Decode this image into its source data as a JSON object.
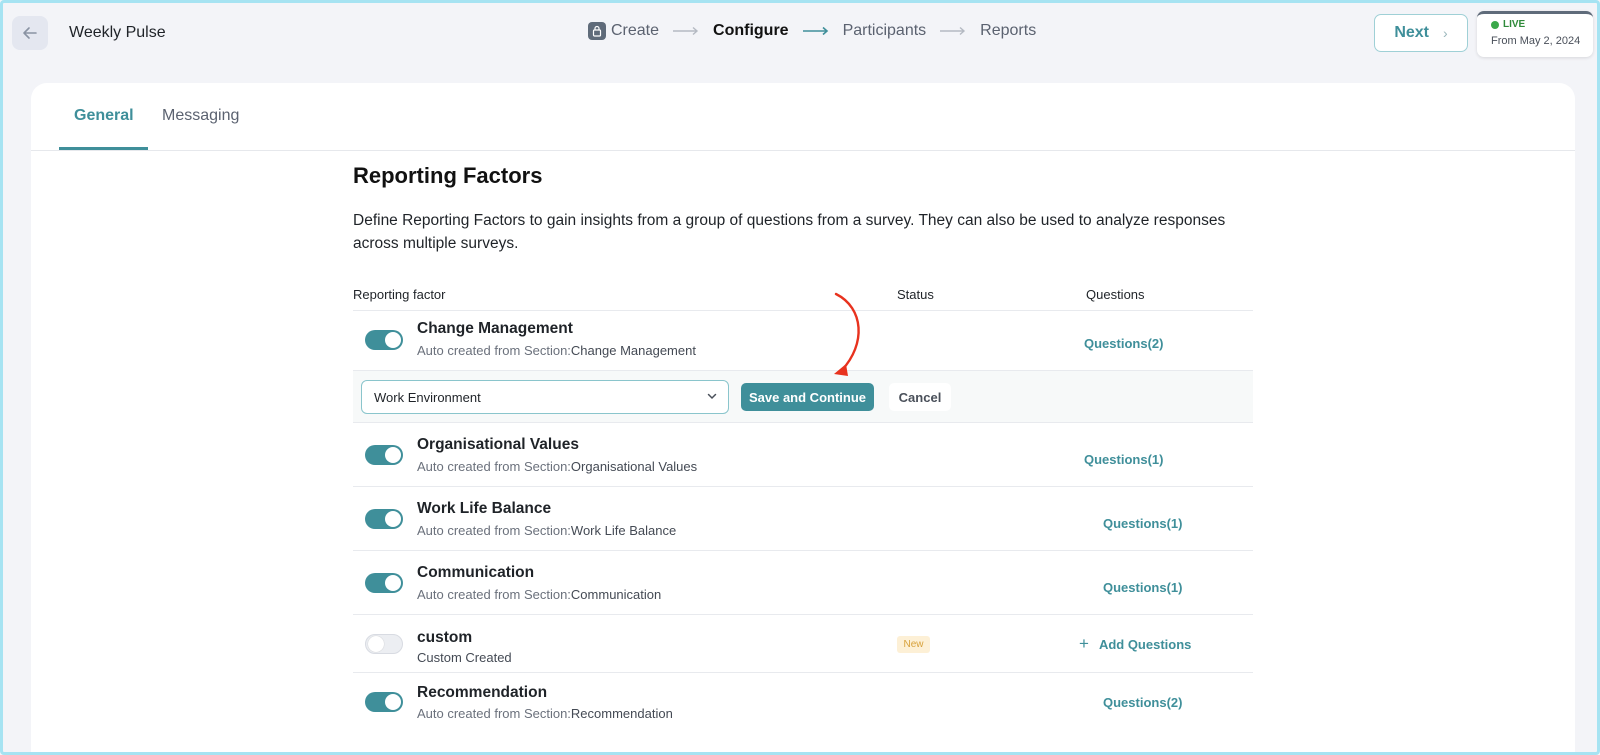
{
  "header": {
    "title": "Weekly Pulse",
    "steps": [
      {
        "label": "Create"
      },
      {
        "label": "Configure"
      },
      {
        "label": "Participants"
      },
      {
        "label": "Reports"
      }
    ],
    "next_label": "Next",
    "live_label": "LIVE",
    "live_date": "From May 2, 2024"
  },
  "tabs": [
    {
      "label": "General"
    },
    {
      "label": "Messaging"
    }
  ],
  "section": {
    "title": "Reporting Factors",
    "description": "Define Reporting Factors to gain insights from a group of questions from a survey. They can also be used to analyze responses across multiple surveys."
  },
  "table": {
    "col_factor": "Reporting factor",
    "col_status": "Status",
    "col_questions": "Questions"
  },
  "edit_row": {
    "selected": "Work Environment",
    "save_label": "Save and Continue",
    "cancel_label": "Cancel"
  },
  "rows": [
    {
      "title": "Change Management",
      "sub_prefix": "Auto created from Section:",
      "sub_section": "Change Management",
      "questions": "Questions(2)",
      "enabled": true
    },
    {
      "title": "Organisational Values",
      "sub_prefix": "Auto created from Section:",
      "sub_section": "Organisational Values",
      "questions": "Questions(1)",
      "enabled": true
    },
    {
      "title": "Work Life Balance",
      "sub_prefix": "Auto created from Section:",
      "sub_section": "Work Life Balance",
      "questions": "Questions(1)",
      "enabled": true
    },
    {
      "title": "Communication",
      "sub_prefix": "Auto created from Section:",
      "sub_section": "Communication",
      "questions": "Questions(1)",
      "enabled": true
    },
    {
      "title": "custom",
      "sub_prefix": "Custom Created",
      "sub_section": "",
      "status": "New",
      "questions": "Add Questions",
      "enabled": false
    },
    {
      "title": "Recommendation",
      "sub_prefix": "Auto created from Section:",
      "sub_section": "Recommendation",
      "questions": "Questions(2)",
      "enabled": true
    }
  ],
  "colors": {
    "accent": "#3f8f9a",
    "annotation_arrow": "#e8321e",
    "live": "#3aa84a"
  }
}
